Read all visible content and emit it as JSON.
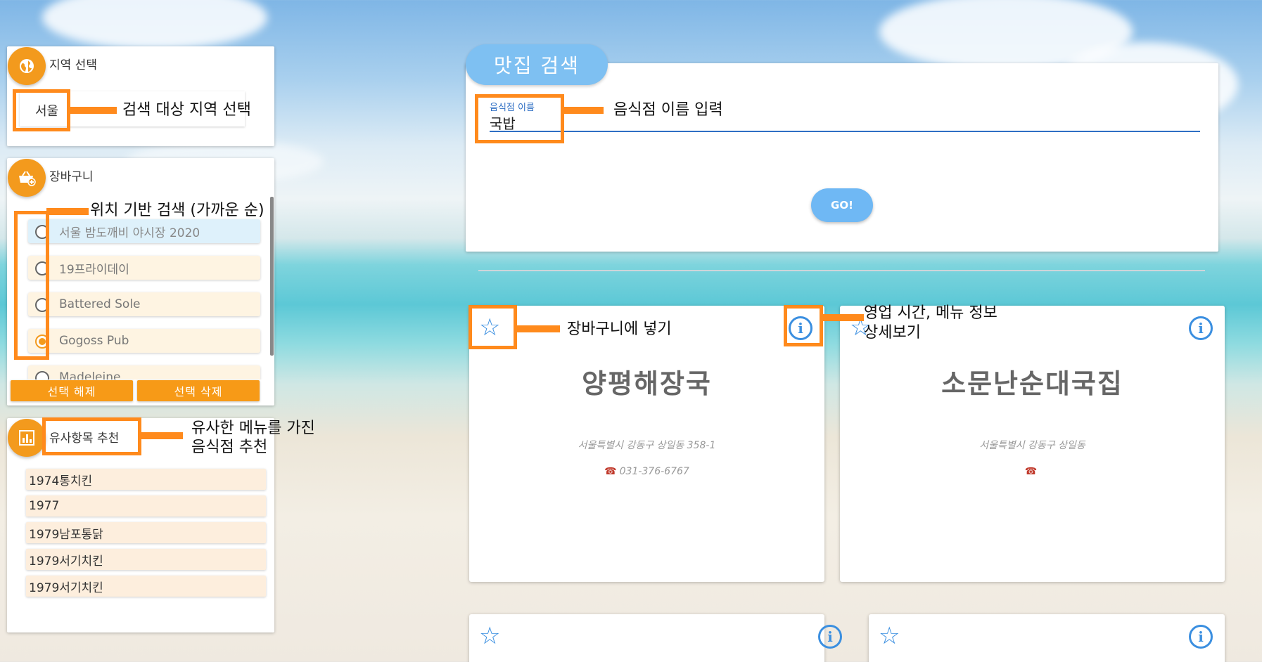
{
  "region": {
    "title": "지역 선택",
    "icon": "globe-icon",
    "selected": "서울",
    "annotation": "검색 대상 지역 선택"
  },
  "cart": {
    "title": "장바구니",
    "icon": "cart-add-icon",
    "annotation": "위치 기반 검색 (가까운 순)",
    "items": [
      {
        "label": "서울 밤도깨비 야시장 2020",
        "checked": false,
        "highlight": true
      },
      {
        "label": "19프라이데이",
        "checked": false,
        "highlight": false
      },
      {
        "label": "Battered Sole",
        "checked": false,
        "highlight": false
      },
      {
        "label": "Gogoss Pub",
        "checked": true,
        "highlight": false
      },
      {
        "label": "Madeleine",
        "checked": false,
        "highlight": false
      }
    ],
    "deselect_label": "선택 해제",
    "delete_label": "선택 삭제"
  },
  "recommend": {
    "title": "유사항목 추천",
    "icon": "bar-chart-icon",
    "annotation_line1": "유사한 메뉴를 가진",
    "annotation_line2": "음식점 추천",
    "items": [
      "1974통치킨",
      "1977",
      "1979남포통닭",
      "1979서기치킨",
      "1979서기치킨"
    ]
  },
  "search": {
    "tab_label": "맛집 검색",
    "field_label": "음식점 이름",
    "field_value": "국밥",
    "annotation": "음식점 이름 입력",
    "go_label": "GO!"
  },
  "annotations": {
    "add_to_cart": "장바구니에 넣기",
    "detail_line1": "영업 시간, 메뉴 정보",
    "detail_line2": "상세보기"
  },
  "results": [
    {
      "name": "양평해장국",
      "address": "서울특별시 강동구 상일동 358-1",
      "phone": "031-376-6767"
    },
    {
      "name": "소문난순대국집",
      "address": "서울특별시 강동구 상일동",
      "phone": ""
    },
    {
      "name": "",
      "address": "",
      "phone": ""
    },
    {
      "name": "",
      "address": "",
      "phone": ""
    }
  ],
  "colors": {
    "accent_orange": "#f39a1d",
    "annotation_orange": "#ff8a1c",
    "primary_blue": "#3b8fe0",
    "tab_blue": "#7ec0f2"
  }
}
